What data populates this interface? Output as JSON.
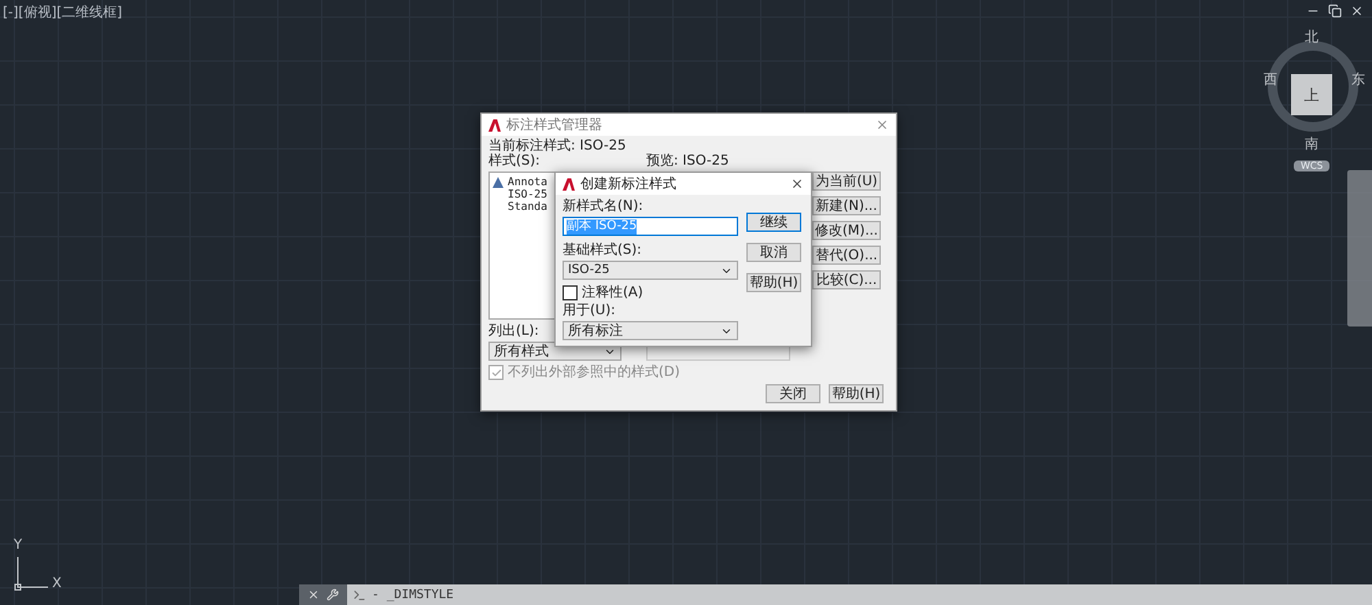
{
  "viewport_label": "[-][俯视][二维线框]",
  "viewcube": {
    "north": "北",
    "south": "南",
    "east": "东",
    "west": "西",
    "face": "上",
    "ucs": "WCS"
  },
  "ucs_axes": {
    "x": "X",
    "y": "Y"
  },
  "manager_dialog": {
    "title": "标注样式管理器",
    "current_style": "当前标注样式: ISO-25",
    "styles_label": "样式(S):",
    "styles": [
      {
        "name": "Annota",
        "annotative": true,
        "selected": false
      },
      {
        "name": "ISO-25",
        "annotative": false,
        "selected": false
      },
      {
        "name": "Standa",
        "annotative": false,
        "selected": false
      }
    ],
    "preview_label": "预览: ISO-25",
    "list_label": "列出(L):",
    "list_value": "所有样式",
    "xref_checkbox": {
      "label": "不列出外部参照中的样式(D)",
      "checked": true,
      "disabled": true
    },
    "side_buttons": [
      "为当前(U)",
      "新建(N)...",
      "修改(M)...",
      "替代(O)...",
      "比较(C)..."
    ],
    "buttons": [
      "关闭",
      "帮助(H)"
    ]
  },
  "new_style_dialog": {
    "title": "创建新标注样式",
    "name_label": "新样式名(N):",
    "name_value": "副本 ISO-25",
    "name_selected": true,
    "base_label": "基础样式(S):",
    "base_value": "ISO-25",
    "annotative_checkbox": {
      "label": "注释性(A)",
      "checked": false
    },
    "use_label": "用于(U):",
    "use_value": "所有标注",
    "buttons": [
      "继续",
      "取消",
      "帮助(H)"
    ]
  },
  "command_line": {
    "text": "- _DIMSTYLE"
  }
}
